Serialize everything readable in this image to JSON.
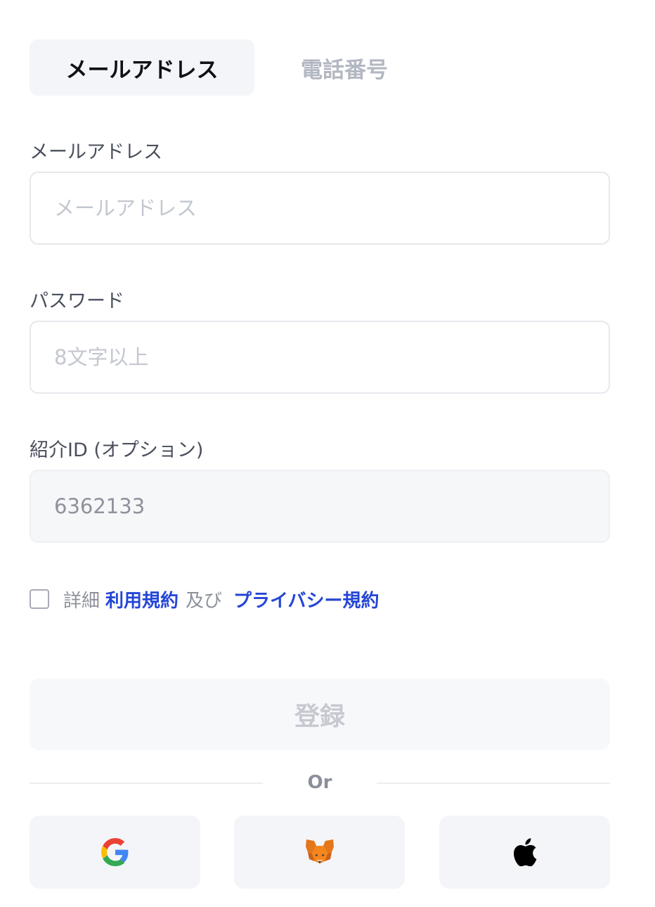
{
  "tabs": {
    "email": "メールアドレス",
    "phone": "電話番号"
  },
  "email_field": {
    "label": "メールアドレス",
    "placeholder": "メールアドレス"
  },
  "password_field": {
    "label": "パスワード",
    "placeholder": "8文字以上"
  },
  "referral_field": {
    "label": "紹介ID (オプション)",
    "value": "6362133"
  },
  "terms": {
    "prefix": "詳細",
    "terms_link": "利用規約",
    "conjunction": "及び",
    "privacy_link": "プライバシー規約",
    "checked": false
  },
  "submit_label": "登録",
  "divider_label": "Or",
  "social_logins": [
    {
      "icon": "google-icon"
    },
    {
      "icon": "metamask-fox-icon"
    },
    {
      "icon": "apple-icon"
    }
  ],
  "colors": {
    "link": "#2446d6",
    "tab_active_bg": "#f4f5f8",
    "disabled_text": "#c6c9d0"
  }
}
